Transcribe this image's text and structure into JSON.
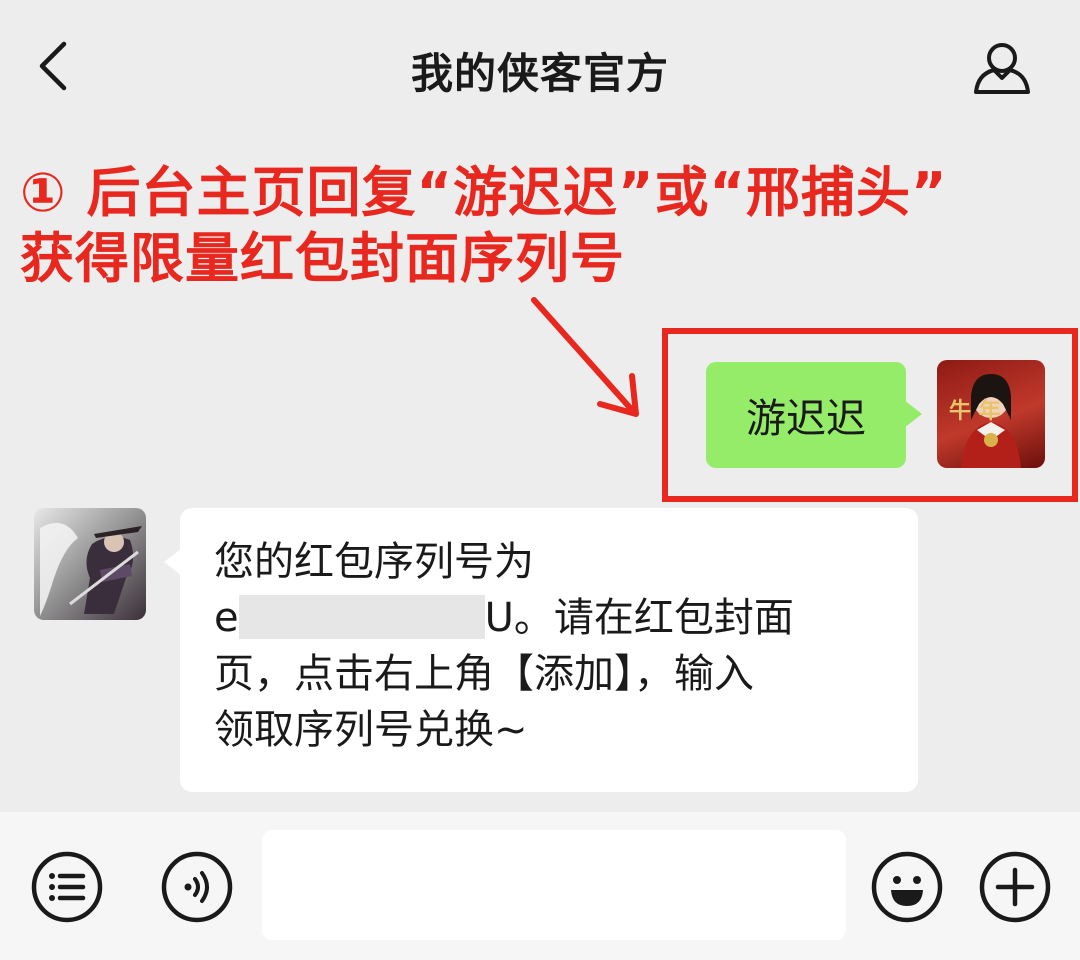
{
  "header": {
    "title": "我的侠客官方"
  },
  "annotation": {
    "line1": "① 后台主页回复“游迟迟”或“邢捕头”",
    "line2": "获得限量红包封面序列号"
  },
  "messages": {
    "outgoing": {
      "text": "游迟迟",
      "avatar_text": "牛 年"
    },
    "incoming": {
      "line1": "您的红包序列号为",
      "code_prefix": "e",
      "code_suffix": "U。请在红包封面",
      "line3": "页，点击右上角【添加】，输入",
      "line4": "领取序列号兑换~"
    }
  },
  "input_bar": {
    "placeholder": "",
    "icons": [
      "menu-list-icon",
      "voice-icon",
      "emoji-icon",
      "plus-icon"
    ]
  },
  "colors": {
    "accent_red": "#e8281f",
    "outgoing_bubble": "#95ec69",
    "background": "#ededed"
  }
}
